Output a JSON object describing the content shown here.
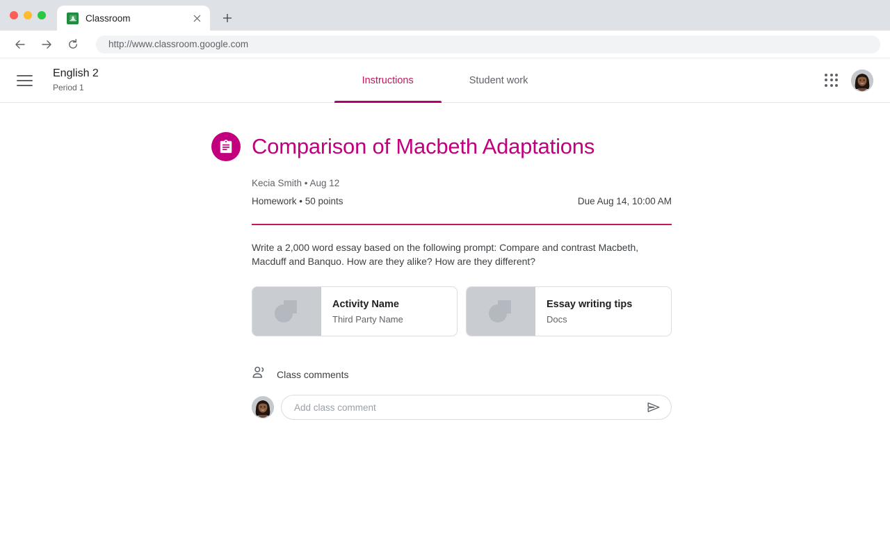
{
  "browser": {
    "traffic_lights": [
      "close",
      "minimize",
      "maximize"
    ],
    "tab": {
      "title": "Classroom",
      "favicon": "google-classroom-icon",
      "close_label": "×"
    },
    "new_tab_label": "+",
    "back_label": "←",
    "forward_label": "→",
    "reload_label": "⟳",
    "url": "http://www.classroom.google.com"
  },
  "app_header": {
    "menu_icon": "hamburger-menu-icon",
    "class_name": "English 2",
    "class_period": "Period 1",
    "tabs": [
      {
        "label": "Instructions",
        "active": true
      },
      {
        "label": "Student work",
        "active": false
      }
    ],
    "apps_icon": "apps-grid-icon",
    "account_avatar": "user-avatar"
  },
  "assignment": {
    "icon": "assignment-clipboard-icon",
    "title": "Comparison of Macbeth Adaptations",
    "author": "Kecia Smith",
    "posted_date": "Aug 12",
    "author_line": "Kecia Smith  • Aug 12",
    "category": "Homework",
    "points": "50 points",
    "category_line": "Homework • 50 points",
    "due": "Due Aug 14, 10:00 AM",
    "description": "Write a 2,000 word essay based on the following prompt: Compare and contrast Macbeth, Macduff and Banquo. How are they alike? How are they different?",
    "attachments": [
      {
        "title": "Activity Name",
        "subtitle": "Third Party Name",
        "thumb": "generic-placeholder-thumbnail"
      },
      {
        "title": "Essay writing tips",
        "subtitle": "Docs",
        "thumb": "generic-placeholder-thumbnail"
      }
    ]
  },
  "comments": {
    "icon": "people-icon",
    "heading": "Class comments",
    "avatar": "user-avatar",
    "input_value": "",
    "placeholder": "Add class comment",
    "send_icon": "send-icon"
  },
  "colors": {
    "accent_magenta": "#c2007e",
    "tab_underline": "#b4006e",
    "divider": "#c2185b",
    "text_primary": "#3c4043",
    "text_secondary": "#5f6368",
    "chrome_bg": "#dee1e6"
  }
}
